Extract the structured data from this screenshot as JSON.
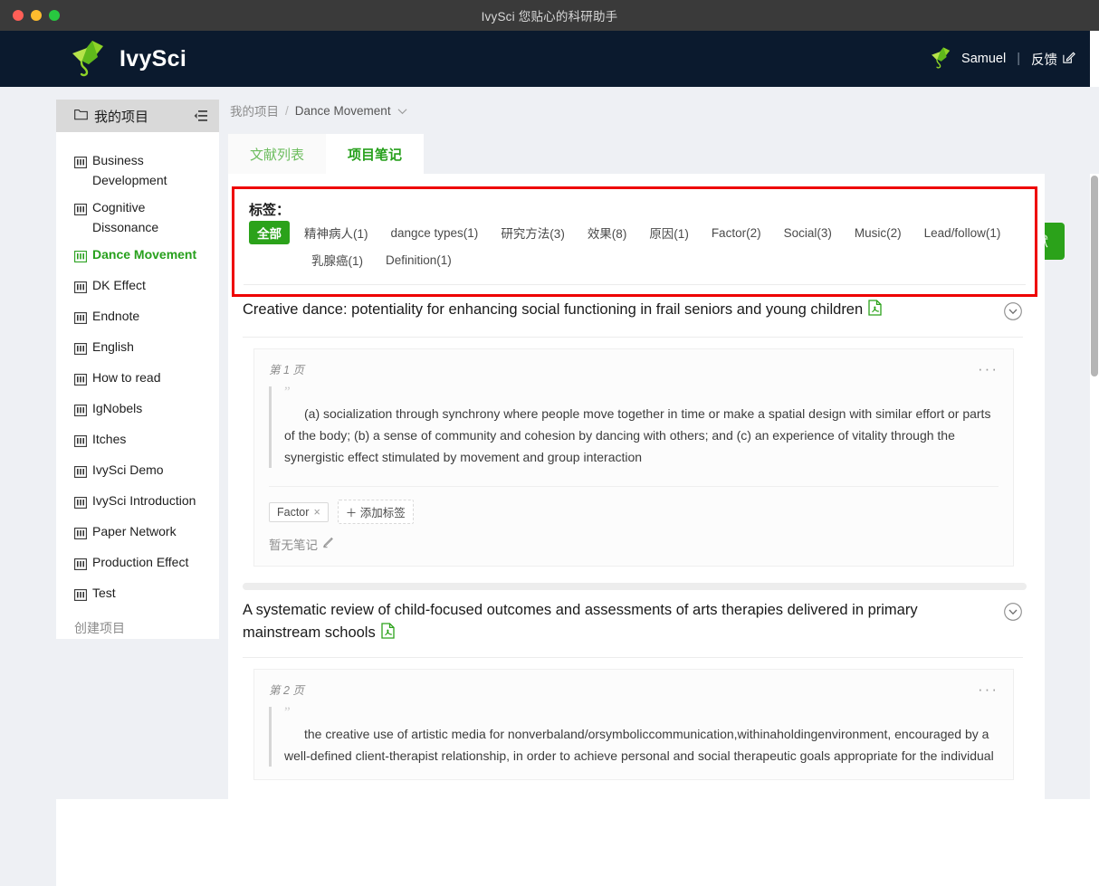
{
  "window": {
    "title": "IvySci 您贴心的科研助手",
    "traffic_lights": [
      "close-red",
      "minimize-yellow",
      "maximize-green"
    ]
  },
  "header": {
    "brand_name": "IvySci",
    "logo_icon": "ivysci-leaf-logo",
    "user_avatar_icon": "ivysci-leaf-avatar",
    "user_name": "Samuel",
    "separator": "|",
    "feedback_label": "反馈",
    "feedback_icon": "edit-square-icon"
  },
  "sidebar": {
    "header_label": "我的项目",
    "header_icon": "folder-icon",
    "collapse_icon": "collapse-panel-icon",
    "items": [
      {
        "label": "Business Development",
        "icon": "project-icon",
        "active": false
      },
      {
        "label": "Cognitive Dissonance",
        "icon": "project-icon",
        "active": false
      },
      {
        "label": "Dance Movement",
        "icon": "project-icon",
        "active": true
      },
      {
        "label": "DK Effect",
        "icon": "project-icon",
        "active": false
      },
      {
        "label": "Endnote",
        "icon": "project-icon",
        "active": false
      },
      {
        "label": "English",
        "icon": "project-icon",
        "active": false
      },
      {
        "label": "How to read",
        "icon": "project-icon",
        "active": false
      },
      {
        "label": "IgNobels",
        "icon": "project-icon",
        "active": false
      },
      {
        "label": "Itches",
        "icon": "project-icon",
        "active": false
      },
      {
        "label": "IvySci Demo",
        "icon": "project-icon",
        "active": false
      },
      {
        "label": "IvySci Introduction",
        "icon": "project-icon",
        "active": false
      },
      {
        "label": "Paper Network",
        "icon": "project-icon",
        "active": false
      },
      {
        "label": "Production Effect",
        "icon": "project-icon",
        "active": false
      },
      {
        "label": "Test",
        "icon": "project-icon",
        "active": false
      }
    ],
    "create_label": "创建项目"
  },
  "breadcrumb": {
    "root": "我的项目",
    "separator": "/",
    "current": "Dance Movement",
    "dropdown_icon": "chevron-down-icon"
  },
  "tabs": [
    {
      "label": "文献列表",
      "active": false
    },
    {
      "label": "项目笔记",
      "active": true
    }
  ],
  "import_button": {
    "label": "导入文献"
  },
  "tag_filter": {
    "label": "标签：",
    "highlight_color": "#ee0000",
    "accent_color": "#2ba21a",
    "row1": [
      {
        "label": "全部",
        "selected": true
      },
      {
        "label": "精神病人(1)",
        "selected": false
      },
      {
        "label": "dangce types(1)",
        "selected": false
      },
      {
        "label": "研究方法(3)",
        "selected": false
      },
      {
        "label": "效果(8)",
        "selected": false
      },
      {
        "label": "原因(1)",
        "selected": false
      },
      {
        "label": "Factor(2)",
        "selected": false
      },
      {
        "label": "Social(3)",
        "selected": false
      },
      {
        "label": "Music(2)",
        "selected": false
      },
      {
        "label": "Lead/follow(1)",
        "selected": false
      }
    ],
    "row2": [
      {
        "label": "乳腺癌(1)",
        "selected": false
      },
      {
        "label": "Definition(1)",
        "selected": false
      }
    ]
  },
  "papers": [
    {
      "title": "Creative dance: potentiality for enhancing social functioning in frail seniors and young children",
      "pdf_icon": "pdf-file-icon",
      "collapse_icon": "chevron-down-circle-icon",
      "note": {
        "page_label": "第 1 页",
        "more_icon": "ellipsis-icon",
        "quote_mark": "”",
        "quote_text": "(a) socialization through synchrony where people move together in time or make a spatial design with similar effort or parts of the body; (b) a sense of community and cohesion by dancing with others; and (c) an experience of vitality through the synergistic effect stimulated by movement and group interaction",
        "tags": [
          {
            "label": "Factor",
            "remove_icon": "close-icon"
          }
        ],
        "add_tag_label": "添加标签",
        "add_tag_icon": "plus-icon",
        "empty_note_label": "暂无笔记",
        "empty_note_icon": "pencil-icon"
      }
    },
    {
      "title": "A systematic review of child-focused outcomes and assessments of arts therapies delivered in primary mainstream schools",
      "pdf_icon": "pdf-file-icon",
      "collapse_icon": "chevron-down-circle-icon",
      "note": {
        "page_label": "第 2 页",
        "more_icon": "ellipsis-icon",
        "quote_mark": "”",
        "quote_text": "the creative use of artistic media for nonverbaland/orsymboliccommunication,withinaholdingenvironment, encouraged by a well-defined client-therapist relationship, in order to achieve personal and social therapeutic goals appropriate for the individual"
      }
    }
  ],
  "scrollbars": {
    "vertical_name": "page-vertical-scrollbar",
    "horizontal_name": "paper-horizontal-scrollbar"
  }
}
